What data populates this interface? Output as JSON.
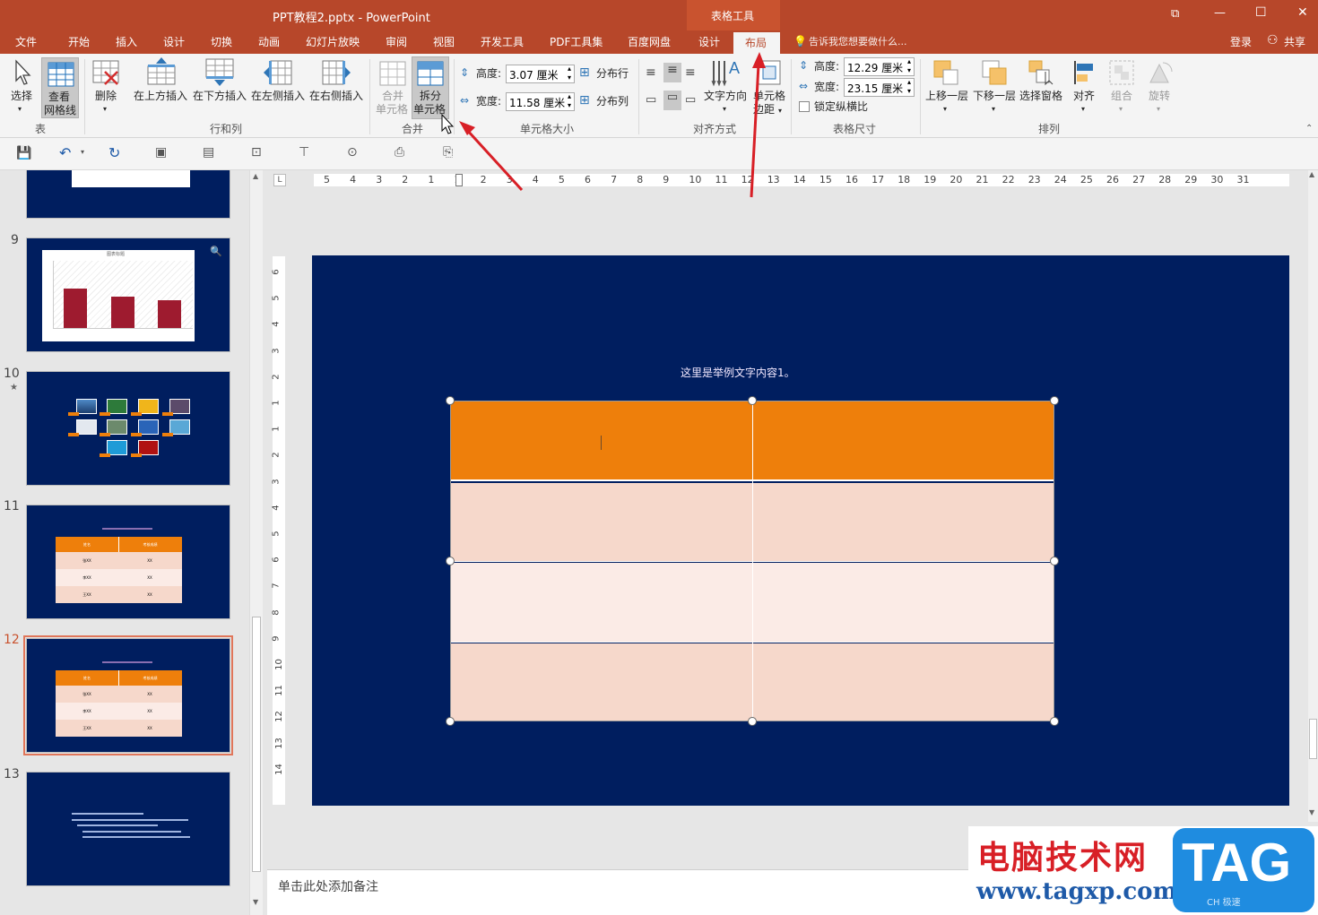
{
  "window": {
    "title": "PPT教程2.pptx - PowerPoint",
    "context_tab_group": "表格工具",
    "controls": {
      "restore": "⧉",
      "minimize": "—",
      "maximize": "☐",
      "close": "✕"
    }
  },
  "tabs": [
    "文件",
    "开始",
    "插入",
    "设计",
    "切换",
    "动画",
    "幻灯片放映",
    "审阅",
    "视图",
    "开发工具",
    "PDF工具集",
    "百度网盘",
    "设计",
    "布局"
  ],
  "active_tab": "布局",
  "tell_me": "告诉我您想要做什么...",
  "account": {
    "login": "登录",
    "share": "共享"
  },
  "ribbon": {
    "table": {
      "select": "选择",
      "gridlines_1": "查看",
      "gridlines_2": "网格线",
      "group": "表"
    },
    "rows_cols": {
      "delete": "删除",
      "insert_above": "在上方插入",
      "insert_below": "在下方插入",
      "insert_left": "在左侧插入",
      "insert_right": "在右侧插入",
      "group": "行和列"
    },
    "merge": {
      "merge_1": "合并",
      "merge_2": "单元格",
      "split_1": "拆分",
      "split_2": "单元格",
      "group": "合并"
    },
    "cell_size": {
      "height_label": "高度:",
      "height_value": "3.07 厘米",
      "width_label": "宽度:",
      "width_value": "11.58 厘米",
      "dist_rows": "分布行",
      "dist_cols": "分布列",
      "group": "单元格大小"
    },
    "alignment": {
      "text_direction": "文字方向",
      "cell_margins_1": "单元格",
      "cell_margins_2": "边距",
      "group": "对齐方式"
    },
    "table_size": {
      "height_label": "高度:",
      "height_value": "12.29 厘米",
      "width_label": "宽度:",
      "width_value": "23.15 厘米",
      "lock_ratio": "锁定纵横比",
      "group": "表格尺寸"
    },
    "arrange": {
      "bring_forward": "上移一层",
      "send_backward": "下移一层",
      "selection_pane": "选择窗格",
      "align": "对齐",
      "group_btn": "组合",
      "rotate": "旋转",
      "group": "排列"
    }
  },
  "ruler": {
    "labels": [
      "5",
      "4",
      "3",
      "2",
      "1",
      "1",
      "2",
      "3",
      "4",
      "5",
      "6",
      "7",
      "8",
      "9",
      "10",
      "11",
      "12",
      "13",
      "14",
      "15",
      "16",
      "17",
      "18",
      "19",
      "20",
      "21",
      "22",
      "23",
      "24",
      "25",
      "26",
      "27",
      "28",
      "29",
      "30",
      "31"
    ]
  },
  "vruler": {
    "labels": [
      "6",
      "5",
      "4",
      "3",
      "2",
      "1",
      "1",
      "2",
      "3",
      "4",
      "5",
      "6",
      "7",
      "8",
      "9",
      "10",
      "11",
      "12",
      "13",
      "14"
    ]
  },
  "thumbnails": [
    {
      "num": "9",
      "chart_title": "图表标题"
    },
    {
      "num": "10",
      "star": "★"
    },
    {
      "num": "11",
      "header": [
        "姓名",
        "考核成绩"
      ],
      "rows": [
        [
          "张XX",
          "XX"
        ],
        [
          "李XX",
          "XX"
        ],
        [
          "王XX",
          "XX"
        ]
      ]
    },
    {
      "num": "12",
      "header": [
        "姓名",
        "考核成绩"
      ],
      "rows": [
        [
          "张XX",
          "XX"
        ],
        [
          "李XX",
          "XX"
        ],
        [
          "王XX",
          "XX"
        ]
      ]
    },
    {
      "num": "13"
    }
  ],
  "slide": {
    "caption": "这里是举例文字内容1。"
  },
  "notes_placeholder": "单击此处添加备注",
  "watermark": {
    "title": "电脑技术网",
    "url": "www.tagxp.com",
    "tag": "TAG",
    "small": "CH 极速"
  },
  "colors": {
    "accent": "#b7472a",
    "slide_bg": "#001e5f",
    "table_header": "#ee7f0b",
    "row_a": "#f6d8cb",
    "row_b": "#fbebe6",
    "arrow": "#d81f26"
  }
}
